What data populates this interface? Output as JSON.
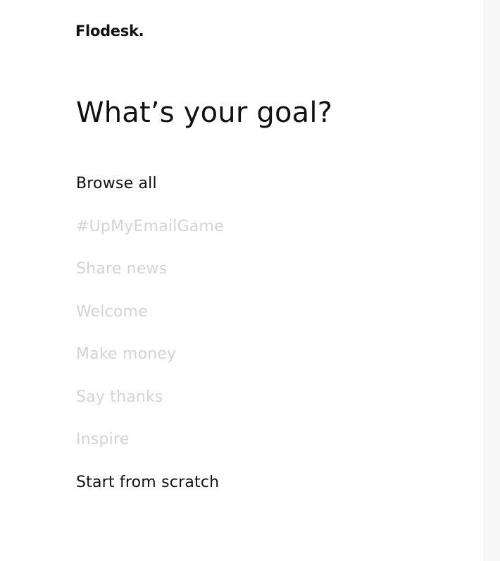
{
  "brand": {
    "logo_text": "Flodesk."
  },
  "page": {
    "heading": "What’s your goal?"
  },
  "goals": [
    {
      "label": "Browse all",
      "state": "active"
    },
    {
      "label": "#UpMyEmailGame",
      "state": "muted"
    },
    {
      "label": "Share news",
      "state": "muted"
    },
    {
      "label": "Welcome",
      "state": "muted"
    },
    {
      "label": "Make money",
      "state": "muted"
    },
    {
      "label": "Say thanks",
      "state": "muted"
    },
    {
      "label": "Inspire",
      "state": "muted"
    },
    {
      "label": "Start from scratch",
      "state": "active"
    }
  ],
  "colors": {
    "text_active": "#111111",
    "text_muted": "#d3d3d3",
    "background": "#ffffff",
    "side_strip": "#f7f7f7"
  }
}
